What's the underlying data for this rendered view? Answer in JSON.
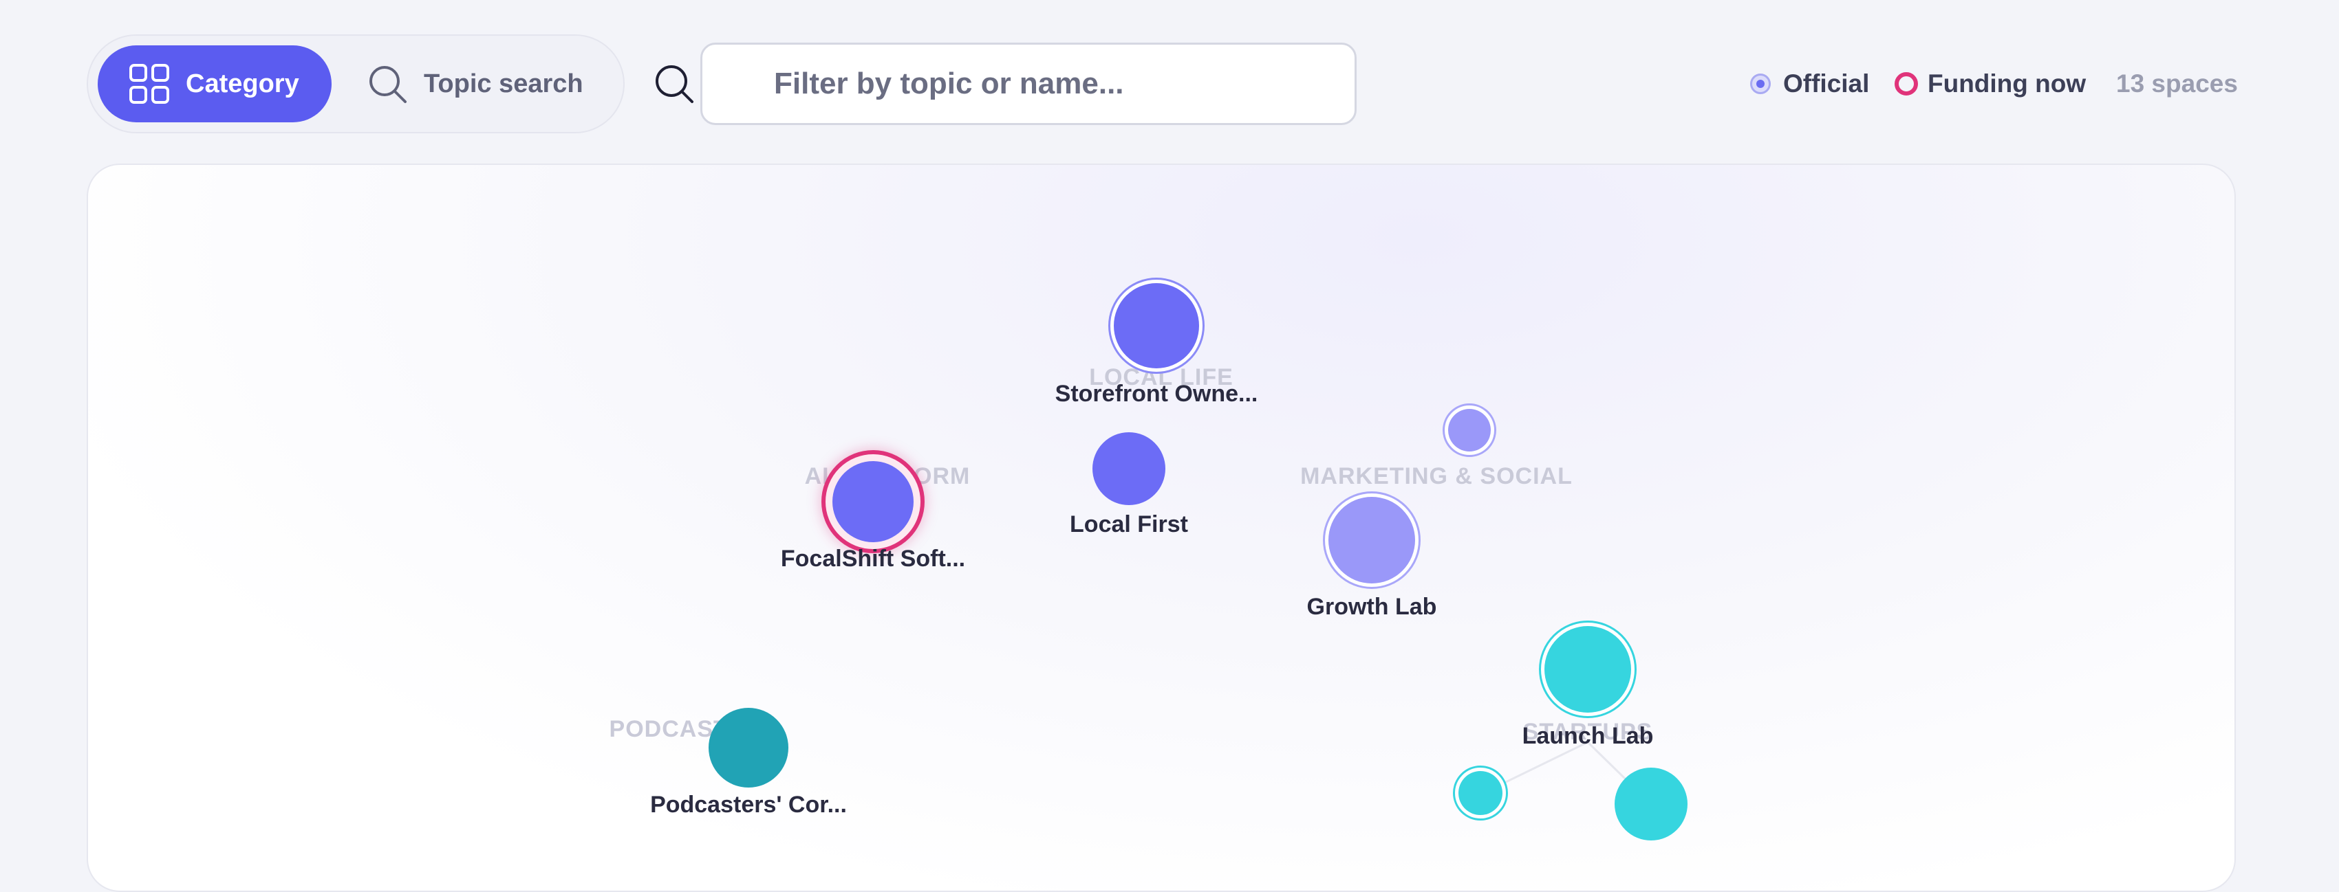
{
  "toolbar": {
    "modes": [
      {
        "label": "Category",
        "icon": "grid-icon",
        "active": true
      },
      {
        "label": "Topic search",
        "icon": "search-icon",
        "active": false
      }
    ],
    "filter_placeholder": "Filter by topic or name...",
    "filter_value": ""
  },
  "legend": {
    "official_label": "Official",
    "funding_label": "Funding now",
    "count_label": "13 spaces"
  },
  "colors": {
    "accent": "#5b5cf0",
    "indigo": "#6c6cf6",
    "lavender": "#9a98f9",
    "teal": "#21a3b5",
    "cyan": "#36d5df",
    "funding": "#e0337a"
  },
  "groups": [
    {
      "label": "LOCAL LIFE"
    },
    {
      "label": "AI PLATFORM"
    },
    {
      "label": "MARKETING & SOCIAL"
    },
    {
      "label": "PODCASTS"
    },
    {
      "label": "STARTUPS"
    }
  ],
  "spaces": [
    {
      "label": "Storefront Owne...",
      "official": true,
      "funding": false
    },
    {
      "label": "Local First",
      "official": false,
      "funding": false
    },
    {
      "label": "FocalShift Soft...",
      "official": false,
      "funding": true
    },
    {
      "label": "",
      "official": true,
      "funding": false
    },
    {
      "label": "Growth Lab",
      "official": true,
      "funding": false
    },
    {
      "label": "Launch Lab",
      "official": true,
      "funding": false
    },
    {
      "label": "Podcasters' Cor...",
      "official": false,
      "funding": false
    },
    {
      "label": "",
      "official": true,
      "funding": false
    },
    {
      "label": "",
      "official": false,
      "funding": false
    }
  ]
}
